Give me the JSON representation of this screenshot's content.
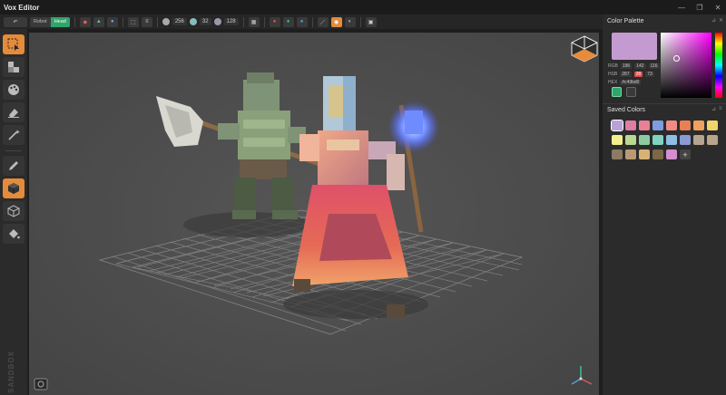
{
  "app": {
    "title": "Vox Editor"
  },
  "toolbar": {
    "mode_labels": [
      "Robot",
      "Head"
    ],
    "resolution_values": [
      "256",
      "32",
      "128"
    ]
  },
  "color_palette": {
    "title": "Color Palette",
    "current_color": "#c49bd0",
    "rgb_label": "RGB",
    "rgb_values": [
      "196",
      "142",
      "116"
    ],
    "hsb_label": "HSB",
    "hsb_values": [
      "287",
      "28",
      "73"
    ],
    "hex_label": "HEX",
    "hex_value": "#c49bd0"
  },
  "saved_colors": {
    "title": "Saved Colors",
    "swatches": [
      "#b9a2d8",
      "#e07ba5",
      "#e88098",
      "#7f9ddc",
      "#ef8b84",
      "#e97f56",
      "#f0a15e",
      "#f2d56a",
      "#f2ef8c",
      "#b7d88f",
      "#8ccba0",
      "#7fd3c0",
      "#8dbfe6",
      "#8a9ad3",
      "#b6a48e",
      "#b8a58a",
      "#8c7a63",
      "#b99a72",
      "#d6b375",
      "#7a6747",
      "#d38fcf"
    ],
    "add_label": "+"
  },
  "brand": {
    "text": "SANDBOX"
  }
}
